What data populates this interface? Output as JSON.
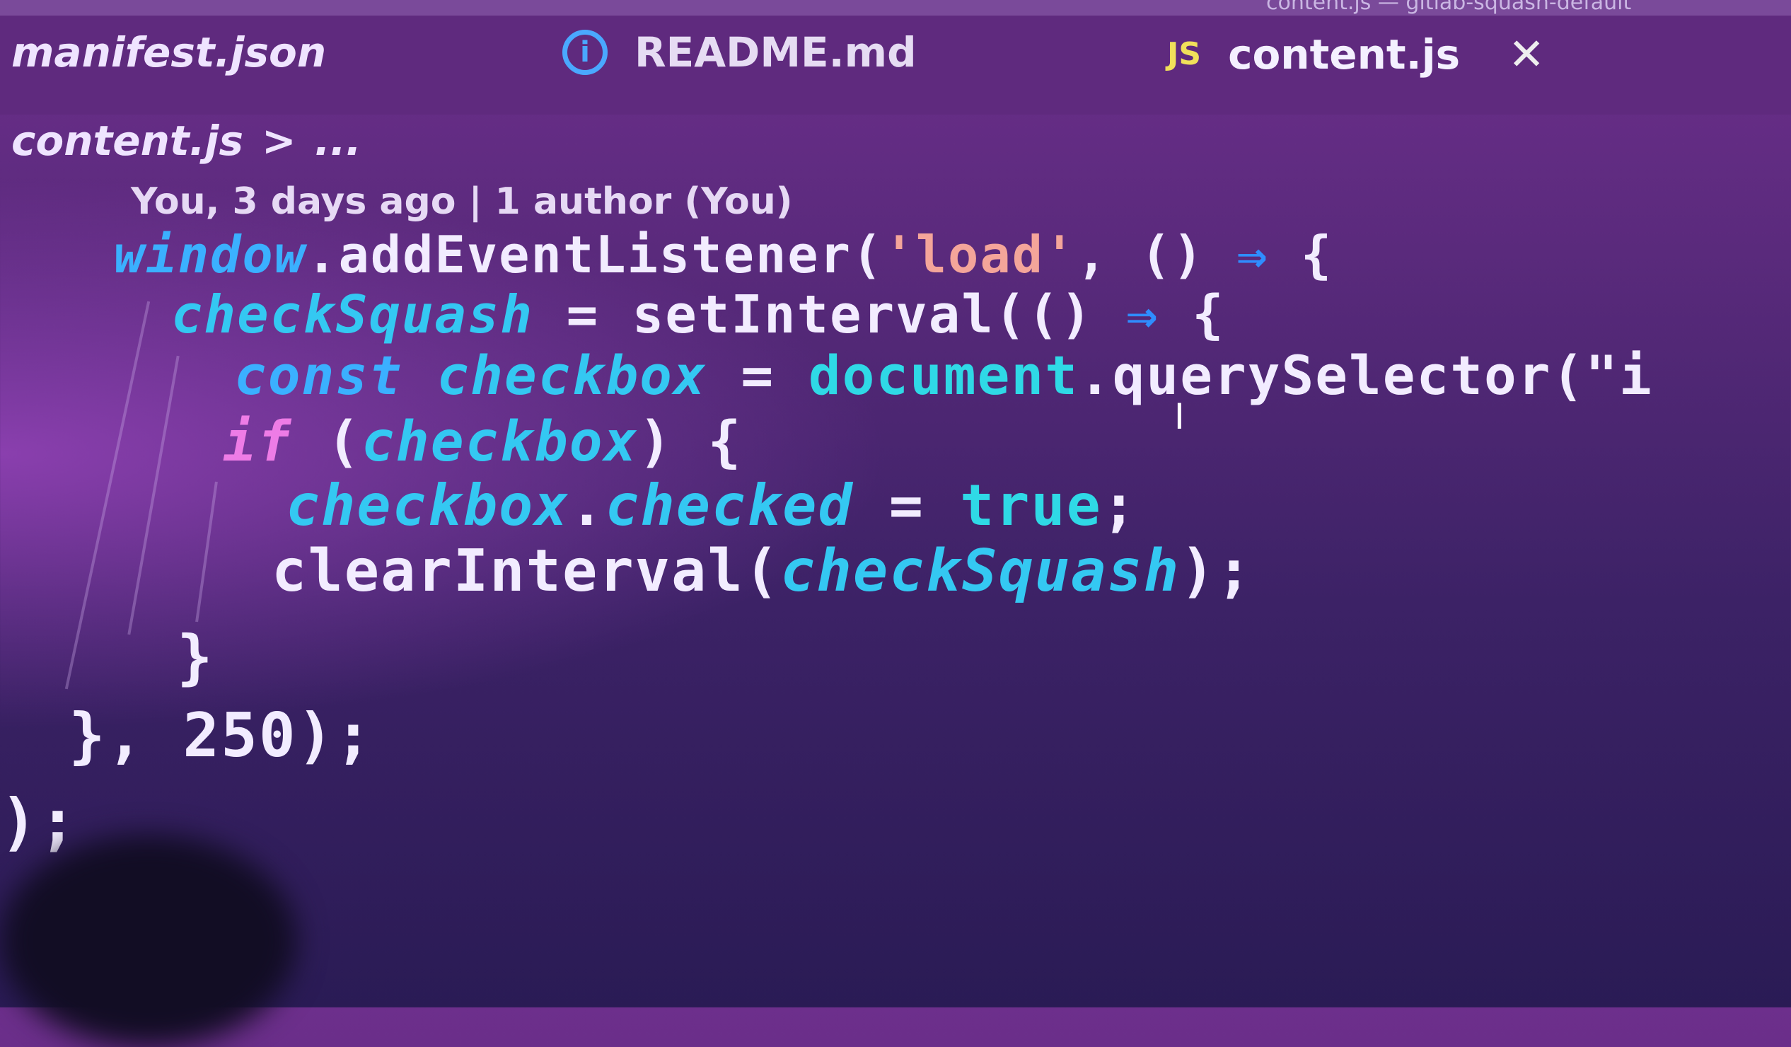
{
  "window": {
    "title": "content.js — gitlab-squash-default"
  },
  "tabs": [
    {
      "label": "manifest.json",
      "icon": "none"
    },
    {
      "label": "README.md",
      "icon": "info-icon",
      "icon_glyph": "i"
    },
    {
      "label": "content.js",
      "icon": "js-icon",
      "icon_glyph": "JS",
      "close": "✕",
      "active": true
    }
  ],
  "breadcrumb": {
    "file": "content.js",
    "separator": ">",
    "more": "..."
  },
  "blame": "You, 3 days ago | 1 author (You)",
  "code": [
    [
      [
        "k",
        "window"
      ],
      [
        "w",
        ".addEventListener("
      ],
      [
        "s",
        "'load'"
      ],
      [
        "w",
        ", () "
      ],
      [
        "a",
        "⇒"
      ],
      [
        "w",
        " {"
      ]
    ],
    [
      [
        "v",
        "checkSquash"
      ],
      [
        "w",
        " = setInterval(() "
      ],
      [
        "a",
        "⇒"
      ],
      [
        "w",
        " {"
      ]
    ],
    [
      [
        "k",
        "const"
      ],
      [
        "w",
        " "
      ],
      [
        "v",
        "checkbox"
      ],
      [
        "w",
        " = "
      ],
      [
        "c",
        "document"
      ],
      [
        "w",
        ".querySelector(\"i"
      ]
    ],
    [
      [
        "p",
        "if"
      ],
      [
        "w",
        " ("
      ],
      [
        "v",
        "checkbox"
      ],
      [
        "w",
        ") {"
      ]
    ],
    [
      [
        "v",
        "checkbox"
      ],
      [
        "w",
        "."
      ],
      [
        "v",
        "checked"
      ],
      [
        "w",
        " = "
      ],
      [
        "c",
        "true"
      ],
      [
        "w",
        ";"
      ]
    ],
    [
      [
        "w",
        "clearInterval("
      ],
      [
        "v",
        "checkSquash"
      ],
      [
        "w",
        ");"
      ]
    ],
    [
      [
        "w",
        "}"
      ]
    ],
    [
      [
        "w",
        "}, "
      ],
      [
        "w",
        "250"
      ],
      [
        "w",
        ");"
      ]
    ],
    [
      [
        "w",
        ");"
      ]
    ]
  ]
}
